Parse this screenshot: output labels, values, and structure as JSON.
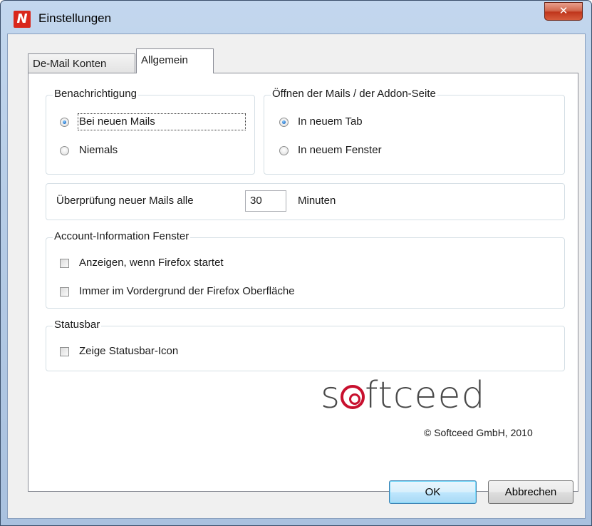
{
  "window": {
    "title": "Einstellungen",
    "icon_letter": "N",
    "close_glyph": "✕"
  },
  "tabs": [
    {
      "label": "De-Mail Konten",
      "active": false
    },
    {
      "label": "Allgemein",
      "active": true
    }
  ],
  "notification": {
    "legend": "Benachrichtigung",
    "options": [
      {
        "label": "Bei neuen Mails",
        "selected": true
      },
      {
        "label": "Niemals",
        "selected": false
      }
    ]
  },
  "open_mode": {
    "legend": "Öffnen der Mails / der Addon-Seite",
    "options": [
      {
        "label": "In neuem Tab",
        "selected": true
      },
      {
        "label": "In neuem Fenster",
        "selected": false
      }
    ]
  },
  "check_interval": {
    "label": "Überprüfung neuer Mails alle",
    "value": "30",
    "unit": "Minuten"
  },
  "account_window": {
    "legend": "Account-Information Fenster",
    "options": [
      {
        "label": "Anzeigen, wenn Firefox startet",
        "checked": false
      },
      {
        "label": "Immer im Vordergrund der Firefox Oberfläche",
        "checked": false
      }
    ]
  },
  "statusbar": {
    "legend": "Statusbar",
    "options": [
      {
        "label": "Zeige Statusbar-Icon",
        "checked": false
      }
    ]
  },
  "branding": {
    "logo_prefix": "s",
    "logo_suffix": "ftceed",
    "copyright": "© Softceed GmbH, 2010",
    "accent": "#c8102e"
  },
  "buttons": {
    "ok": "OK",
    "cancel": "Abbrechen"
  }
}
